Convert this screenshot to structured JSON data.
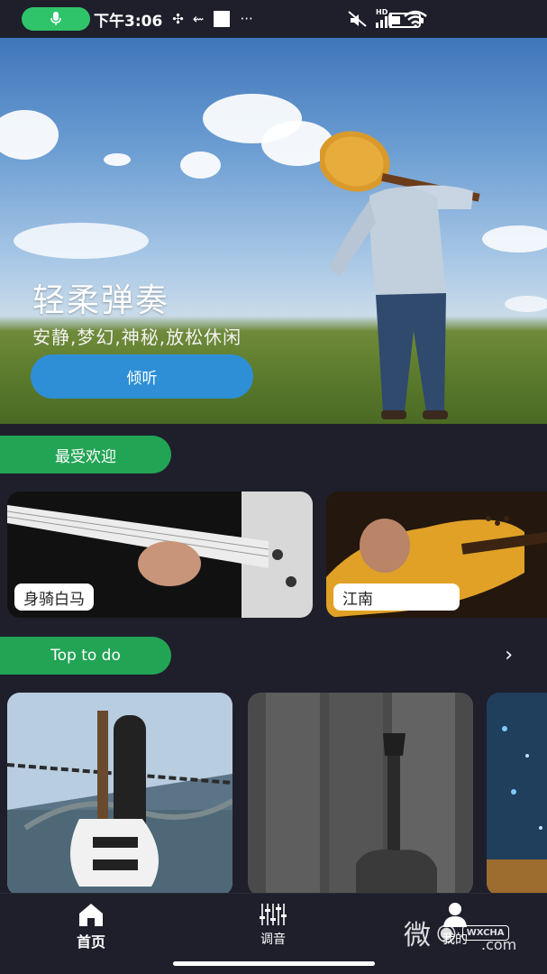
{
  "status_bar": {
    "time": "下午3:06",
    "more": "···",
    "network": "HD"
  },
  "hero": {
    "title": "轻柔弹奏",
    "subtitle": "安静,梦幻,神秘,放松休闲",
    "listen_button": "倾听"
  },
  "sections": {
    "popular": {
      "title": "最受欢迎",
      "cards": [
        {
          "label": "身骑白马"
        },
        {
          "label": "江南"
        }
      ]
    },
    "top_to_do": {
      "title": "Top to do",
      "more_icon": "chevron-right-icon"
    }
  },
  "bottom_nav": {
    "items": [
      {
        "label": "首页",
        "icon": "home-icon",
        "active": true
      },
      {
        "label": "调音",
        "icon": "equalizer-icon",
        "active": false
      },
      {
        "label": "我的",
        "icon": "user-icon",
        "active": false
      }
    ]
  },
  "watermark": {
    "text": "微",
    "badge": "WXCHA",
    "url": ".com"
  },
  "colors": {
    "background": "#1e1f2b",
    "accent_green": "#22a455",
    "button_blue": "#2e8fd6",
    "mic_green": "#2fc46a"
  }
}
